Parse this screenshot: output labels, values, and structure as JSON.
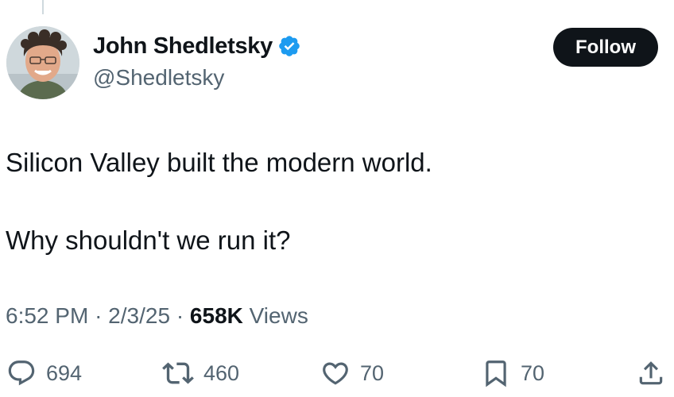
{
  "author": {
    "display_name": "John Shedletsky",
    "handle": "@Shedletsky",
    "verified": true,
    "verified_color": "#1d9bf0"
  },
  "follow_button": {
    "label": "Follow"
  },
  "tweet": {
    "lines": [
      "Silicon Valley built the modern world.",
      "Why shouldn't we run it?"
    ],
    "time": "6:52 PM",
    "date": "2/3/25",
    "separator": "·",
    "views_count": "658K",
    "views_label": "Views"
  },
  "actions": {
    "reply": {
      "icon": "reply-icon",
      "count": "694"
    },
    "retweet": {
      "icon": "retweet-icon",
      "count": "460"
    },
    "like": {
      "icon": "heart-icon",
      "count": "70"
    },
    "bookmark": {
      "icon": "bookmark-icon",
      "count": "70"
    },
    "share": {
      "icon": "share-icon"
    }
  }
}
